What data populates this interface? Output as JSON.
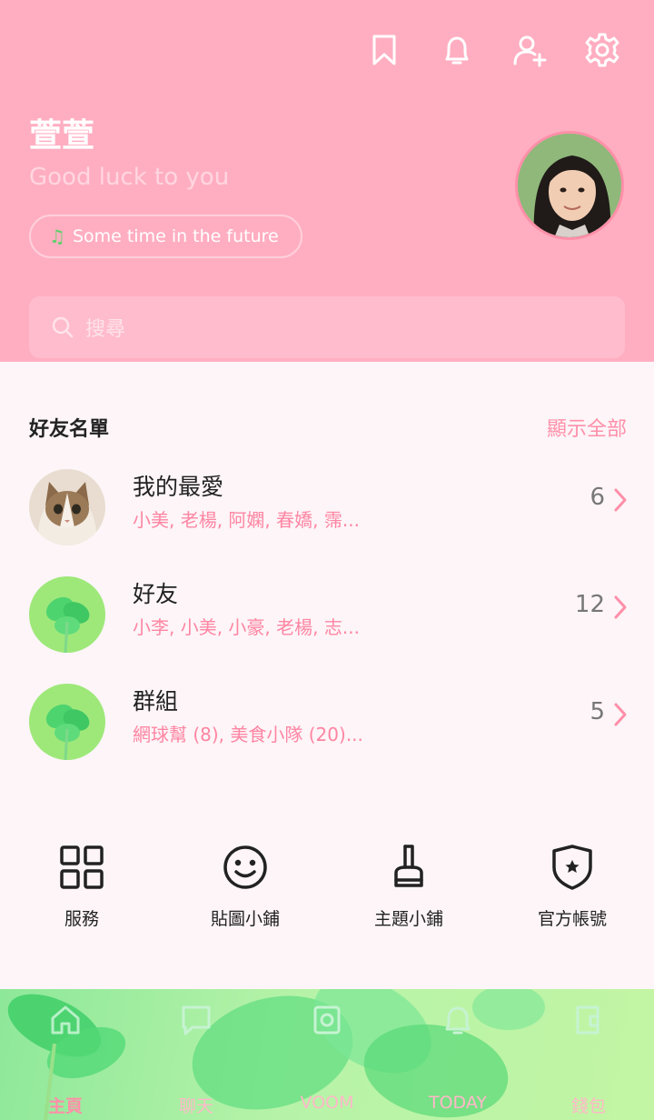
{
  "header": {
    "profile_name": "萱萱",
    "status_message": "Good luck to you",
    "music_title": "Some time in the future",
    "search_placeholder": "搜尋",
    "icons": [
      "bookmark-icon",
      "bell-icon",
      "add-friend-icon",
      "settings-icon"
    ]
  },
  "friends": {
    "title": "好友名單",
    "show_all": "顯示全部",
    "rows": [
      {
        "label": "我的最愛",
        "members": "小美, 老楊, 阿嫻, 春嬌, 霈...",
        "count": "6"
      },
      {
        "label": "好友",
        "members": "小李, 小美, 小豪, 老楊, 志...",
        "count": "12"
      },
      {
        "label": "群組",
        "members": "網球幫 (8), 美食小隊 (20)...",
        "count": "5"
      }
    ]
  },
  "services": [
    {
      "label": "服務",
      "icon": "grid-icon"
    },
    {
      "label": "貼圖小鋪",
      "icon": "smiley-icon"
    },
    {
      "label": "主題小鋪",
      "icon": "brush-icon"
    },
    {
      "label": "官方帳號",
      "icon": "shield-star-icon"
    }
  ],
  "bottom_nav": [
    {
      "label": "主頁",
      "icon": "home-icon",
      "active": true
    },
    {
      "label": "聊天",
      "icon": "chat-icon",
      "active": false
    },
    {
      "label": "VOOM",
      "icon": "voom-icon",
      "active": false
    },
    {
      "label": "TODAY",
      "icon": "today-icon",
      "active": false
    },
    {
      "label": "錢包",
      "icon": "wallet-icon",
      "active": false
    }
  ],
  "colors": {
    "header_bg": "#ffaec1",
    "accent_pink": "#ff8fa9",
    "nav_green": "#b6f3a8"
  }
}
